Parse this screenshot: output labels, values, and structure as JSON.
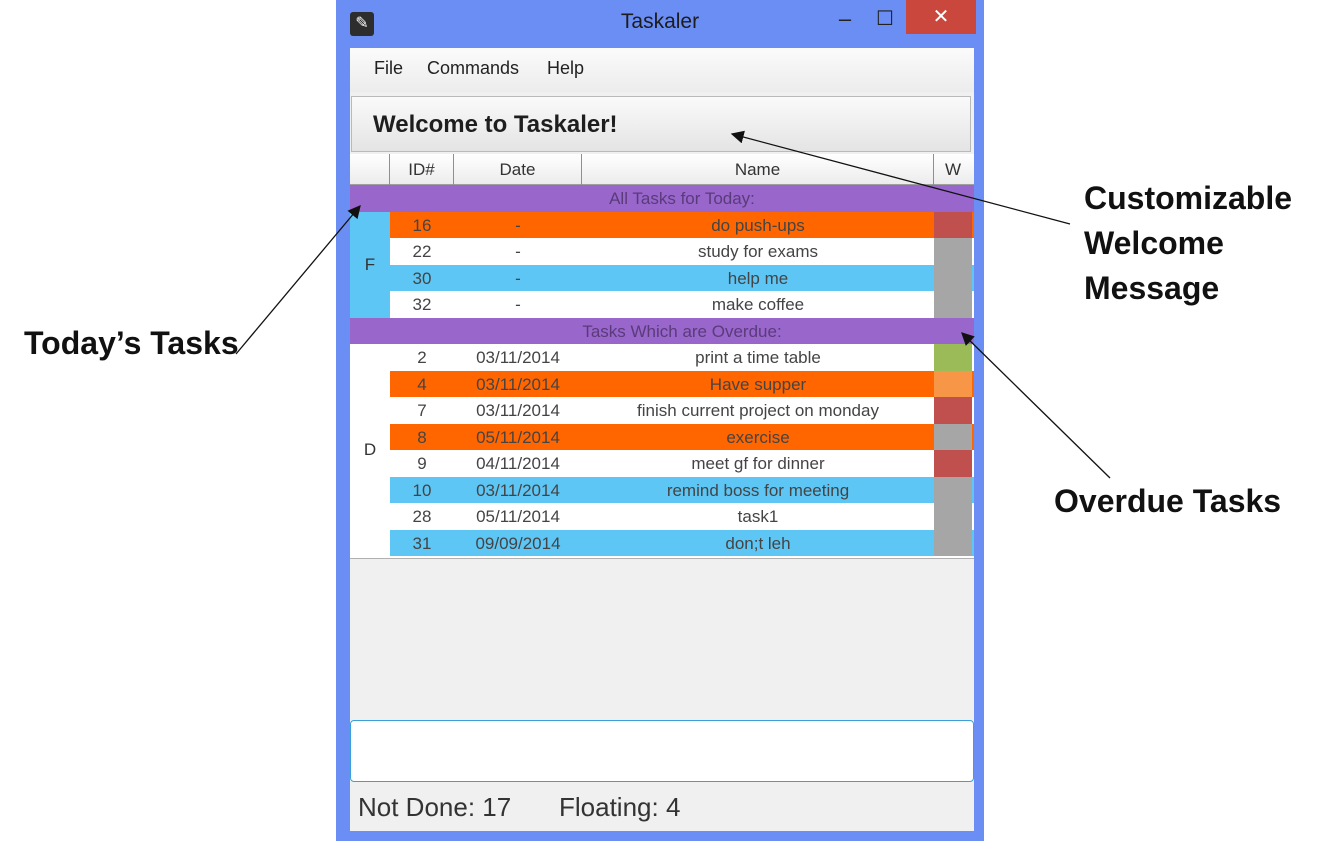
{
  "window": {
    "title": "Taskaler",
    "controls": {
      "minimize": "‒",
      "maximize": "☐",
      "close": "✕"
    }
  },
  "menu": [
    "File",
    "Commands",
    "Help"
  ],
  "welcome": "Welcome to Taskaler!",
  "table": {
    "columns": [
      "",
      "ID#",
      "Date",
      "Name",
      "W"
    ],
    "groups": [
      {
        "key": "F",
        "header": "All Tasks for Today:",
        "label_bg": "#5ec6f5",
        "rows": [
          {
            "id": "16",
            "date": "-",
            "name": "do push-ups",
            "bg": "#ff6600",
            "w": "#c0504d"
          },
          {
            "id": "22",
            "date": "-",
            "name": "study for exams",
            "bg": "#ffffff",
            "w": "#a6a6a6"
          },
          {
            "id": "30",
            "date": "-",
            "name": "help me",
            "bg": "#5ec6f5",
            "w": "#a6a6a6"
          },
          {
            "id": "32",
            "date": "-",
            "name": "make coffee",
            "bg": "#ffffff",
            "w": "#a6a6a6"
          }
        ]
      },
      {
        "key": "D",
        "header": "Tasks Which are Overdue:",
        "label_bg": "#ffffff",
        "rows": [
          {
            "id": "2",
            "date": "03/11/2014",
            "name": "print a time table",
            "bg": "#ffffff",
            "w": "#9bbb59"
          },
          {
            "id": "4",
            "date": "03/11/2014",
            "name": "Have supper",
            "bg": "#ff6600",
            "w": "#f79646"
          },
          {
            "id": "7",
            "date": "03/11/2014",
            "name": "finish current project on monday",
            "bg": "#ffffff",
            "w": "#c0504d"
          },
          {
            "id": "8",
            "date": "05/11/2014",
            "name": "exercise",
            "bg": "#ff6600",
            "w": "#a6a6a6"
          },
          {
            "id": "9",
            "date": "04/11/2014",
            "name": "meet gf for dinner",
            "bg": "#ffffff",
            "w": "#c0504d"
          },
          {
            "id": "10",
            "date": "03/11/2014",
            "name": "remind boss for meeting",
            "bg": "#5ec6f5",
            "w": "#a6a6a6"
          },
          {
            "id": "28",
            "date": "05/11/2014",
            "name": "task1",
            "bg": "#ffffff",
            "w": "#a6a6a6"
          },
          {
            "id": "31",
            "date": "09/09/2014",
            "name": "don;t leh",
            "bg": "#5ec6f5",
            "w": "#a6a6a6"
          }
        ]
      }
    ],
    "group_header_bg": "#9966cc"
  },
  "command_input": {
    "value": "",
    "placeholder": ""
  },
  "status": {
    "not_done": "Not Done: 17",
    "floating": "Floating: 4"
  },
  "annotations": {
    "welcome": [
      "Customizable",
      "Welcome",
      "Message"
    ],
    "today": "Today’s Tasks",
    "overdue": "Overdue Tasks"
  }
}
